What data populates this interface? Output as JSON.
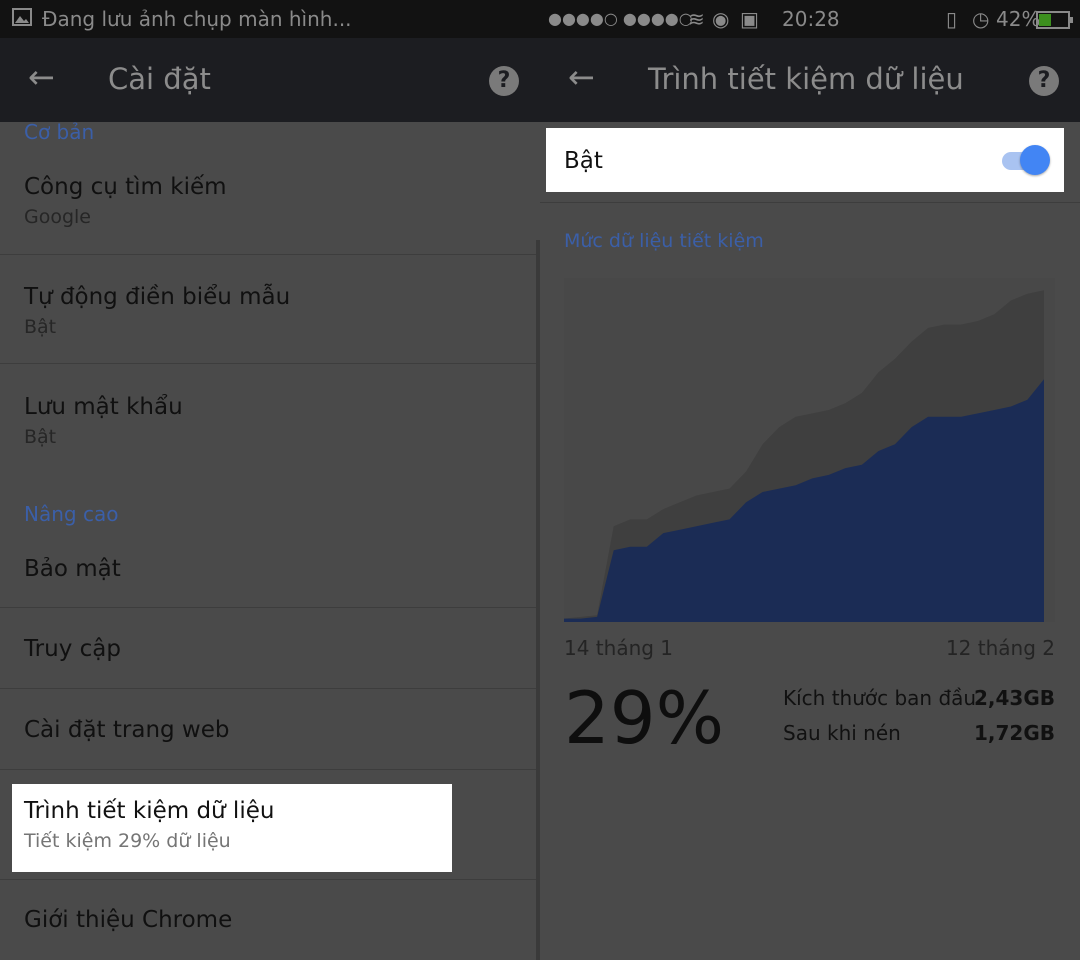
{
  "status_bar": {
    "notification": "Đang lưu ảnh chụp màn hình...",
    "time": "20:28",
    "battery": "42%",
    "signal_dots": "●●●●○ ●●●●○"
  },
  "left_header": {
    "title": "Cài đặt"
  },
  "right_header": {
    "title": "Trình tiết kiệm dữ liệu"
  },
  "settings": {
    "section_basic": "Cơ bản",
    "search_engine": {
      "title": "Công cụ tìm kiếm",
      "subtitle": "Google"
    },
    "autofill": {
      "title": "Tự động điền biểu mẫu",
      "subtitle": "Bật"
    },
    "passwords": {
      "title": "Lưu mật khẩu",
      "subtitle": "Bật"
    },
    "section_advanced": "Nâng cao",
    "security": {
      "title": "Bảo mật"
    },
    "accessibility": {
      "title": "Truy cập"
    },
    "site_settings": {
      "title": "Cài đặt trang web"
    },
    "data_saver": {
      "title": "Trình tiết kiệm dữ liệu",
      "subtitle": "Tiết kiệm 29% dữ liệu"
    },
    "about": {
      "title": "Giới thiệu Chrome"
    }
  },
  "data_saver": {
    "toggle_label": "Bật",
    "toggle_on": true,
    "chart_label": "Mức dữ liệu tiết kiệm",
    "start_date": "14 tháng 1",
    "end_date": "12 tháng 2",
    "percent_saved": "29%",
    "original_size_label": "Kích thước ban đầu",
    "original_size": "2,43GB",
    "compressed_label": "Sau khi nén",
    "compressed_size": "1,72GB"
  },
  "colors": {
    "accent": "#4285f4",
    "original_area": "#3f3f3f",
    "compressed_area": "#1b2c55"
  },
  "chart_data": {
    "type": "area",
    "title": "Mức dữ liệu tiết kiệm",
    "x": [
      "14 tháng 1",
      "",
      "",
      "",
      "",
      "",
      "",
      "",
      "",
      "",
      "",
      "",
      "",
      "",
      "",
      "",
      "",
      "",
      "",
      "",
      "",
      "",
      "",
      "",
      "",
      "",
      "",
      "",
      "",
      "12 tháng 2"
    ],
    "series": [
      {
        "values": [
          0.01,
          0.015,
          0.02,
          0.28,
          0.3,
          0.3,
          0.33,
          0.35,
          0.37,
          0.38,
          0.39,
          0.44,
          0.52,
          0.57,
          0.6,
          0.61,
          0.62,
          0.64,
          0.67,
          0.73,
          0.77,
          0.82,
          0.86,
          0.87,
          0.87,
          0.88,
          0.9,
          0.94,
          0.96,
          0.97
        ]
      },
      {
        "values": [
          0.01,
          0.01,
          0.015,
          0.21,
          0.22,
          0.22,
          0.26,
          0.27,
          0.28,
          0.29,
          0.3,
          0.35,
          0.38,
          0.39,
          0.4,
          0.42,
          0.43,
          0.45,
          0.46,
          0.5,
          0.52,
          0.57,
          0.6,
          0.6,
          0.6,
          0.61,
          0.62,
          0.63,
          0.65,
          0.71
        ]
      }
    ],
    "ylim": [
      0,
      1
    ],
    "grid": false
  }
}
